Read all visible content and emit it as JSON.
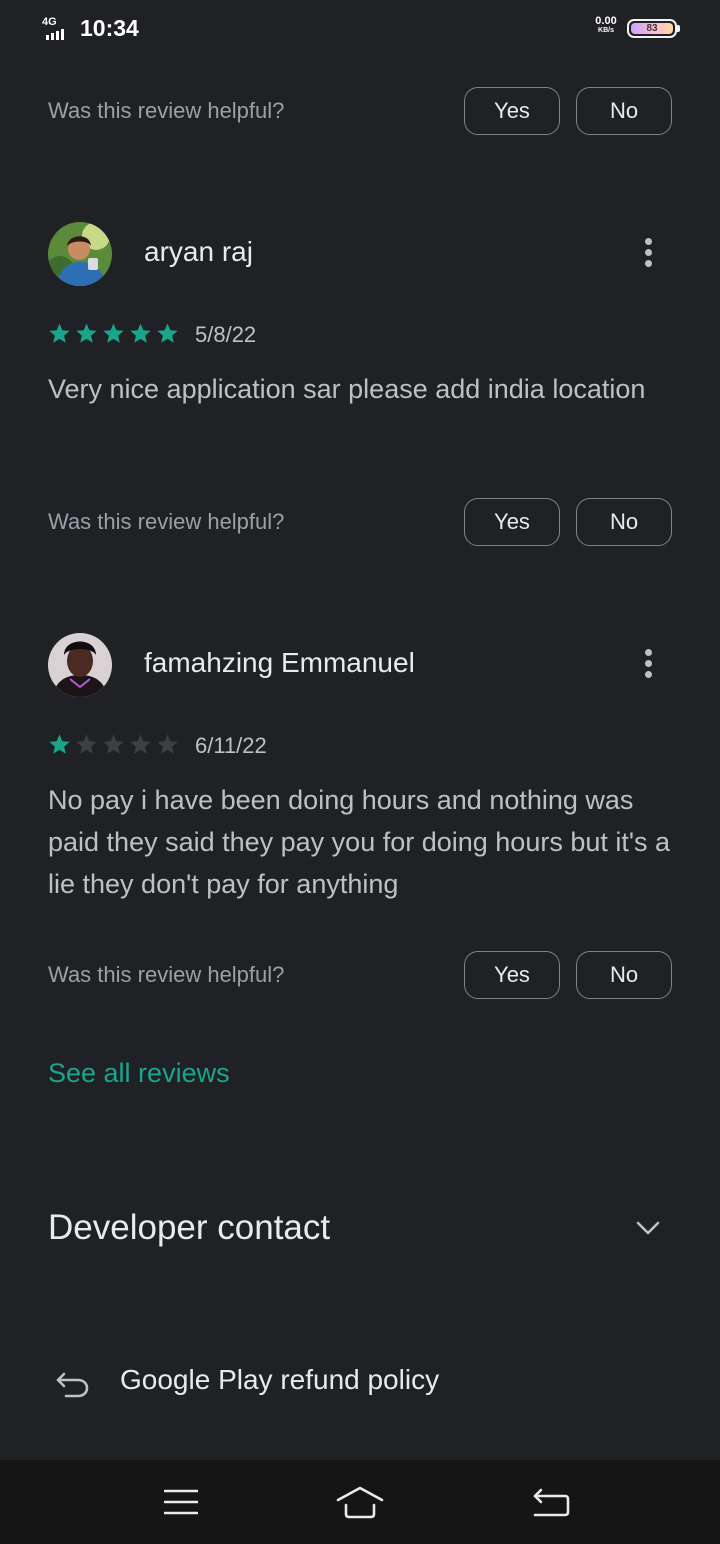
{
  "status_bar": {
    "network": "4G",
    "time": "10:34",
    "net_speed_value": "0.00",
    "net_speed_unit": "KB/s",
    "battery_level": "83"
  },
  "helpful_prompt": "Was this review helpful?",
  "yes_label": "Yes",
  "no_label": "No",
  "reviews": [
    {
      "reviewer": "aryan raj",
      "rating": 5,
      "max_rating": 5,
      "date": "5/8/22",
      "text": "Very nice application sar please add india location"
    },
    {
      "reviewer": "famahzing Emmanuel",
      "rating": 1,
      "max_rating": 5,
      "date": "6/11/22",
      "text": "No pay i have been doing hours and nothing was paid they said they pay you for doing hours but it's a lie they don't pay for anything"
    }
  ],
  "see_all_reviews": "See all reviews",
  "developer_contact": "Developer contact",
  "refund_policy": "Google Play refund policy",
  "colors": {
    "background": "#202124",
    "accent": "#1aa68b",
    "star_filled": "#1aa68b",
    "star_empty": "#3c4043"
  },
  "icons": {
    "more": "more-vert-icon",
    "chevron": "chevron-down-icon",
    "refund": "undo-arrow-icon",
    "nav_menu": "menu-icon",
    "nav_home": "home-icon",
    "nav_back": "back-icon"
  }
}
